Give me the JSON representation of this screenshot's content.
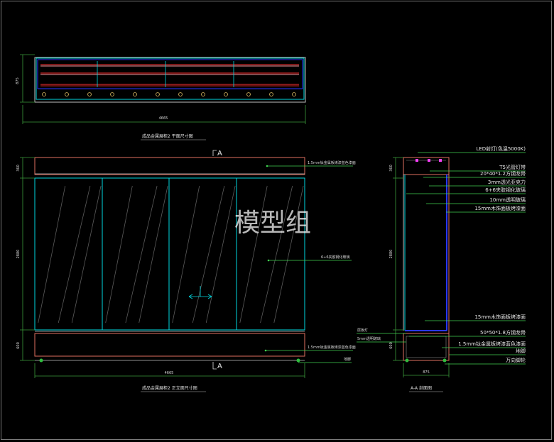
{
  "plan": {
    "dim_width": "4665",
    "dim_height": "875",
    "caption": "成品金属展柜2 平面尺寸图"
  },
  "elevation": {
    "section_mark_top": "A",
    "section_mark_bottom": "A",
    "dim_top": "360",
    "dim_middle": "2880",
    "dim_bottom": "600",
    "dim_width": "4665",
    "note_top": "1.5mm钛金属板烤漆蓝色漆面",
    "note_glass": "6+6夹胶钢化玻璃",
    "note_bottom": "1.5mm钛金属板烤漆蓝色漆面",
    "note_foot": "地脚",
    "caption": "成品金属展柜2 正立面尺寸图"
  },
  "section": {
    "dim_top": "360",
    "dim_middle": "2880",
    "dim_bottom": "600",
    "dim_width": "875",
    "caption": "A-A 剖面图",
    "labels": [
      "LED射灯(色温5000K)",
      "T5光管灯带",
      "20*40*1.2方钢龙骨",
      "3mm透光亚克力",
      "6+6夹胶钢化玻璃",
      "10mm透明玻璃",
      "15mm木饰面板烤漆面"
    ],
    "labels_lower": [
      "15mm木饰面板烤漆面",
      "50*50*1.8方钢龙骨",
      "1.5mm钛金属板烤漆蓝色漆面",
      "地脚",
      "万向脚轮"
    ],
    "labels_left": [
      "层板灯",
      "5mm透明玻璃"
    ]
  },
  "watermark": "模型组"
}
